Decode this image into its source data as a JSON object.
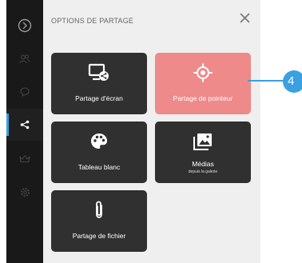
{
  "panel": {
    "title": "OPTIONS DE PARTAGE",
    "close_icon": "close-icon"
  },
  "sidebar": {
    "items": [
      {
        "icon": "chevron-right-circle-icon"
      },
      {
        "icon": "users-icon"
      },
      {
        "icon": "chat-bubble-icon"
      },
      {
        "icon": "share-icon",
        "active": true
      },
      {
        "icon": "crown-icon"
      },
      {
        "icon": "settings-icon"
      }
    ]
  },
  "tiles": [
    {
      "label": "Partage d'écran",
      "sublabel": "",
      "icon": "screen-share-icon"
    },
    {
      "label": "Partage de pointeur",
      "sublabel": "",
      "icon": "crosshair-icon",
      "highlighted": true
    },
    {
      "label": "Tableau blanc",
      "sublabel": "",
      "icon": "palette-icon"
    },
    {
      "label": "Médias",
      "sublabel": "depuis la galerie",
      "icon": "media-gallery-icon"
    },
    {
      "label": "Partage de fichier",
      "sublabel": "",
      "icon": "paperclip-icon"
    }
  ],
  "callout": {
    "number": "4"
  },
  "colors": {
    "sidebar_bg": "#191919",
    "panel_bg": "#efefef",
    "tile_bg": "#303030",
    "tile_highlight": "#ee8a8a",
    "accent": "#3aa0e0"
  }
}
